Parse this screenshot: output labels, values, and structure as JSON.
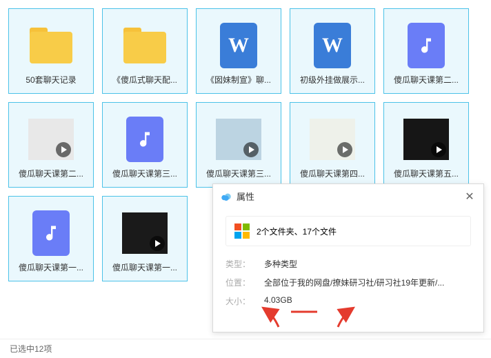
{
  "items": [
    {
      "label": "50套聊天记录",
      "kind": "folder"
    },
    {
      "label": "《傻瓜式聊天配...",
      "kind": "folder"
    },
    {
      "label": "《囡妹制宣》聊...",
      "kind": "doc"
    },
    {
      "label": "初级外挂做展示...",
      "kind": "doc"
    },
    {
      "label": "傻瓜聊天课第二...",
      "kind": "audio"
    },
    {
      "label": "傻瓜聊天课第二...",
      "kind": "video",
      "bg": "#e8e8e8"
    },
    {
      "label": "傻瓜聊天课第三...",
      "kind": "audio"
    },
    {
      "label": "傻瓜聊天课第三...",
      "kind": "video",
      "bg": "#bcd4e2"
    },
    {
      "label": "傻瓜聊天课第四...",
      "kind": "video",
      "bg": "#eef1ea"
    },
    {
      "label": "傻瓜聊天课第五...",
      "kind": "video",
      "bg": "#161616"
    },
    {
      "label": "傻瓜聊天课第一...",
      "kind": "audio"
    },
    {
      "label": "傻瓜聊天课第一...",
      "kind": "video",
      "bg": "#1a1a1a"
    }
  ],
  "panel": {
    "title": "属性",
    "summary": "2个文件夹、17个文件",
    "rows": [
      {
        "k": "类型：",
        "v": "多种类型"
      },
      {
        "k": "位置：",
        "v": "全部位于我的网盘/撩妹研习社/研习社19年更新/..."
      },
      {
        "k": "大小：",
        "v": "4.03GB"
      }
    ]
  },
  "status": "已选中12项"
}
